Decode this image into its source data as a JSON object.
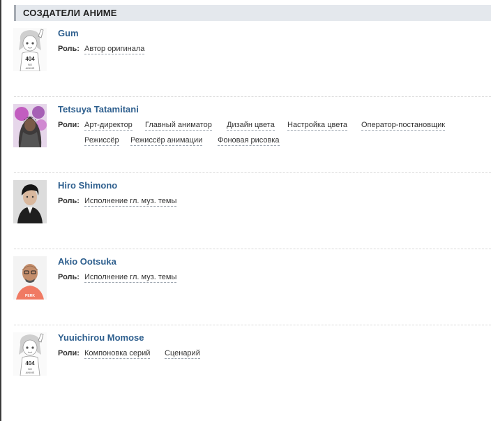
{
  "section": {
    "title": "СОЗДАТЕЛИ АНИМЕ"
  },
  "people": [
    {
      "name": "Gum",
      "roles_label": "Роль:",
      "roles": [
        "Автор оригинала"
      ],
      "avatar": "no-photo-404-anime-girl"
    },
    {
      "name": "Tetsuya Tatamitani",
      "roles_label": "Роли:",
      "roles": [
        "Арт-директор",
        "Главный аниматор",
        "Дизайн цвета",
        "Настройка цвета",
        "Оператор-постановщик",
        "Режиссёр",
        "Режиссёр анимации",
        "Фоновая рисовка"
      ],
      "avatar": "photo-hooded-man-purple"
    },
    {
      "name": "Hiro Shimono",
      "roles_label": "Роль:",
      "roles": [
        "Исполнение гл. муз. темы"
      ],
      "avatar": "photo-man-dark-jacket"
    },
    {
      "name": "Akio Ootsuka",
      "roles_label": "Роль:",
      "roles": [
        "Исполнение гл. муз. темы"
      ],
      "avatar": "photo-bald-man-glasses"
    },
    {
      "name": "Yuuichirou Momose",
      "roles_label": "Роли:",
      "roles": [
        "Компоновка серий",
        "Сценарий"
      ],
      "avatar": "no-photo-404-anime-girl"
    }
  ]
}
